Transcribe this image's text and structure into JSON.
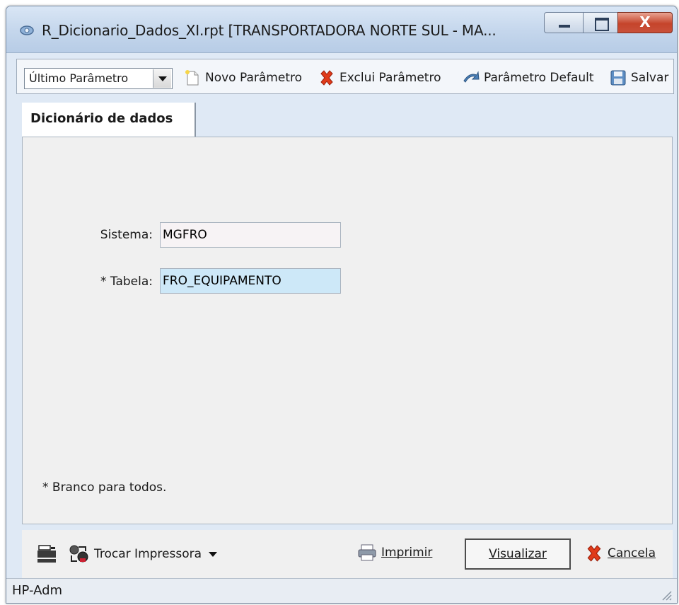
{
  "window": {
    "title": "R_Dicionario_Dados_XI.rpt [TRANSPORTADORA NORTE SUL -  MA...",
    "close_glyph": "X"
  },
  "toolbar": {
    "param_select_value": "Último Parâmetro",
    "new_param_label": "Novo Parâmetro",
    "delete_param_label": "Exclui Parâmetro",
    "default_param_label": "Parâmetro Default",
    "save_label": "Salvar"
  },
  "tabs": [
    {
      "label": "Dicionário de dados",
      "active": true
    }
  ],
  "form": {
    "sistema_label": "Sistema:",
    "sistema_value": "MGFRO",
    "tabela_label": "* Tabela:",
    "tabela_value": "FRO_EQUIPAMENTO",
    "footnote": "* Branco para todos."
  },
  "bottom": {
    "swap_printer_label": "Trocar Impressora",
    "print_label": "Imprimir",
    "preview_label": "Visualizar",
    "cancel_label": "Cancela"
  },
  "status": {
    "text": "HP-Adm"
  },
  "colors": {
    "title_bar": "#c4d6ec",
    "required_field": "#cde8f8",
    "close_button": "#c5442b",
    "delete_icon": "#e03b1a"
  },
  "icons": [
    "app-icon",
    "new-document-icon",
    "delete-x-icon",
    "default-arrow-icon",
    "floppy-save-icon",
    "printer-icon",
    "swap-printer-icon",
    "print-icon",
    "cancel-x-icon",
    "resize-grip-icon"
  ]
}
